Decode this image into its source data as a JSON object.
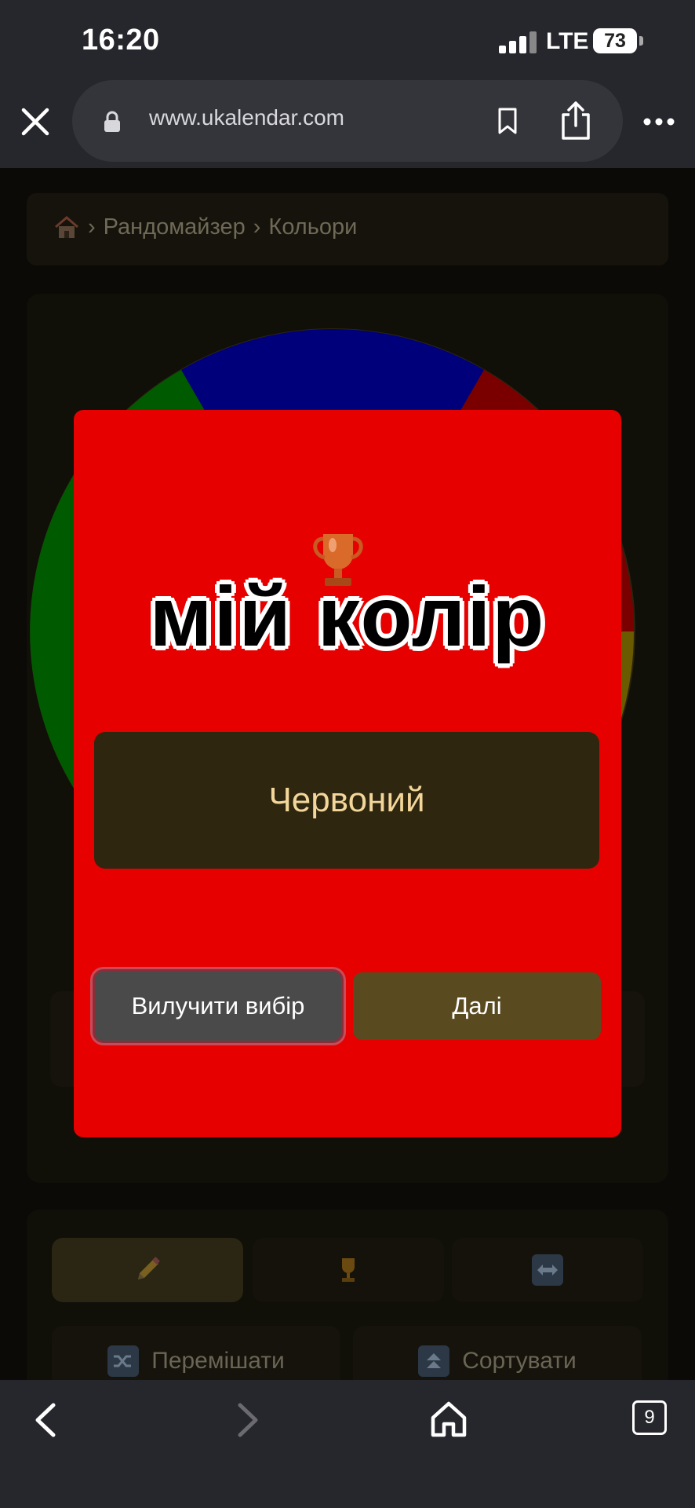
{
  "status_bar": {
    "time": "16:20",
    "network": "LTE",
    "battery": "73"
  },
  "browser": {
    "url": "www.ukalendar.com",
    "icons": [
      "close-icon",
      "lock-icon",
      "bookmark-icon",
      "share-icon",
      "more-icon"
    ]
  },
  "breadcrumb": {
    "items": [
      "Рандомайзер",
      "Кольори"
    ],
    "separator": "›"
  },
  "wheel": {
    "segment_colors": [
      "#00007a",
      "#7a0000",
      "#6a5a00",
      "#005a00"
    ]
  },
  "modal": {
    "background": "#e60000",
    "title": "мій колір",
    "result": "Червоний",
    "remove_label": "Вилучити вибір",
    "next_label": "Далі"
  },
  "controls": {
    "tabs": [
      "edit-icon",
      "trophy-icon",
      "swap-icon"
    ],
    "shuffle_label": "Перемішати",
    "sort_label": "Сортувати"
  },
  "bottom_bar": {
    "tab_count": "9"
  }
}
